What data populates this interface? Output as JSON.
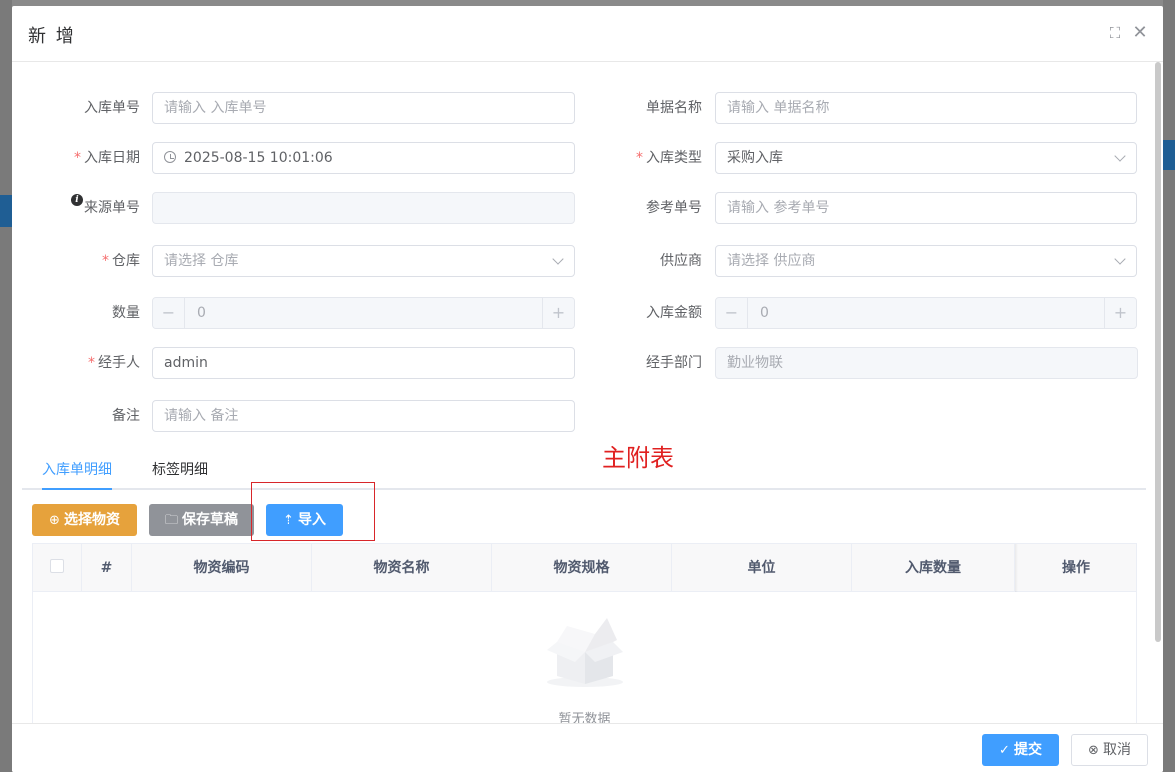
{
  "dialog": {
    "title": "新 增"
  },
  "form": {
    "inbound_no": {
      "label": "入库单号",
      "placeholder": "请输入 入库单号"
    },
    "doc_name": {
      "label": "单据名称",
      "placeholder": "请输入 单据名称"
    },
    "inbound_date": {
      "label": "入库日期",
      "value": "2025-08-15 10:01:06"
    },
    "inbound_type": {
      "label": "入库类型",
      "value": "采购入库"
    },
    "source_no": {
      "label": "来源单号",
      "value": ""
    },
    "ref_no": {
      "label": "参考单号",
      "placeholder": "请输入 参考单号"
    },
    "warehouse": {
      "label": "仓库",
      "placeholder": "请选择 仓库"
    },
    "supplier": {
      "label": "供应商",
      "placeholder": "请选择 供应商"
    },
    "quantity": {
      "label": "数量",
      "value": "0"
    },
    "amount": {
      "label": "入库金额",
      "value": "0"
    },
    "handler": {
      "label": "经手人",
      "value": "admin"
    },
    "handler_dept": {
      "label": "经手部门",
      "value": "勤业物联"
    },
    "remark": {
      "label": "备注",
      "placeholder": "请输入 备注"
    },
    "required_mark": "*"
  },
  "annotation": "主附表",
  "tabs": [
    {
      "label": "入库单明细",
      "active": true
    },
    {
      "label": "标签明细",
      "active": false
    }
  ],
  "toolbar": {
    "select_material": "选择物资",
    "save_draft": "保存草稿",
    "import": "导入"
  },
  "table": {
    "columns": [
      "#",
      "物资编码",
      "物资名称",
      "物资规格",
      "单位",
      "入库数量",
      "操作"
    ],
    "empty_text": "暂无数据"
  },
  "footer": {
    "submit": "提交",
    "cancel": "取消"
  },
  "colors": {
    "primary": "#409eff",
    "warning": "#e6a23c",
    "info": "#909399",
    "required": "#f56c6c",
    "annotation": "#e02020"
  }
}
